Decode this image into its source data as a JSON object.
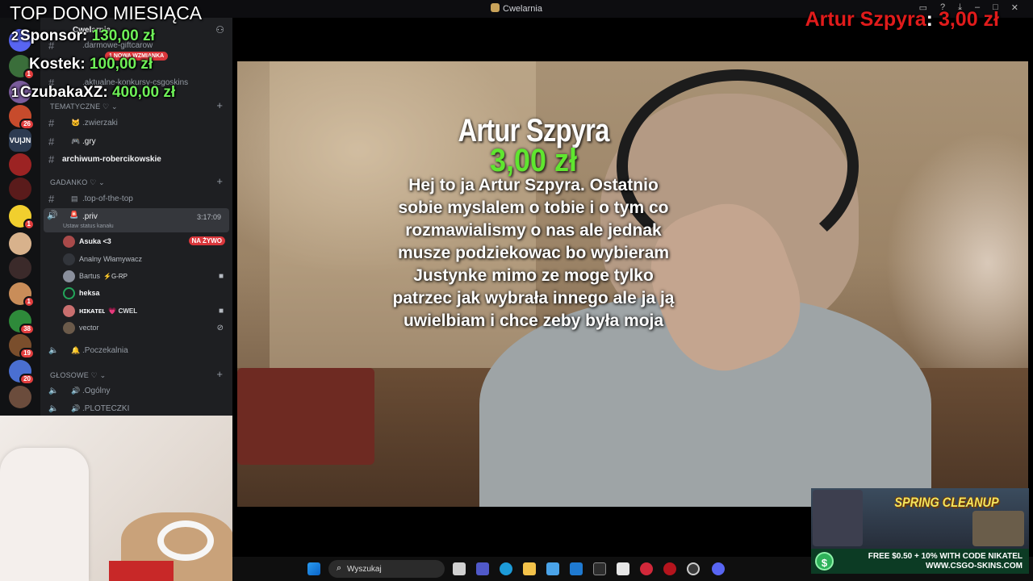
{
  "window": {
    "title": "Cwelarnia"
  },
  "server": {
    "name": "Cwelarnia",
    "mention_badge": "1 NOWA WZMIANKA"
  },
  "channels": {
    "top_items": [
      ".darmowe-giftcarow",
      ".aktualne-konkursy-csgoskins"
    ],
    "tematyczne": {
      "label": "TEMATYCZNE ♡",
      "items": [
        ".zwierzaki",
        ".gry",
        "archiwum-robercikowskie"
      ]
    },
    "gadanko": {
      "label": "GADANKO ♡",
      "items": [
        ".top-of-the-top"
      ]
    },
    "voice_active": {
      "name": ".priv",
      "time": "3:17:09",
      "status": "Ustaw status kanału"
    },
    "members": [
      {
        "name": "Asuka <3",
        "badge": "NA ŻYWO"
      },
      {
        "name": "Analny Włamywacz",
        "tag": ""
      },
      {
        "name": "Bartus",
        "tag": "⚡G-RP"
      },
      {
        "name": "heksa",
        "tag": ""
      },
      {
        "name": "ʜɪᴋᴀᴛᴇʟ",
        "tag": "💗 CWEL"
      },
      {
        "name": "vector",
        "tag": ""
      }
    ],
    "poczekalnia": ".Poczekalnia",
    "glosowe": {
      "label": "GŁOSOWE ♡",
      "items": [
        ".Ogólny",
        ".PLOTECZKI"
      ]
    }
  },
  "server_badges": [
    "1",
    "26",
    "1",
    "1",
    "38",
    "19",
    "20"
  ],
  "server_text_icon": "VU|JN",
  "top_donors": {
    "title": "TOP DONO MIESIĄCA",
    "list": [
      {
        "rank": "2",
        "name": "Sponsor:",
        "amount": "130,00 zł"
      },
      {
        "rank": "",
        "name": "Kostek:",
        "amount": "100,00 zł"
      },
      {
        "rank": "1",
        "name": "CzubakaXZ:",
        "amount": "400,00 zł"
      }
    ]
  },
  "last_donation": {
    "name": "Artur Szpyra",
    "sep": ":",
    "amount": "3,00 zł"
  },
  "alert": {
    "name": "Artur Szpyra",
    "amount": "3,00 zł",
    "message": "Hej to ja Artur Szpyra. Ostatnio sobie myslalem o tobie i o tym co rozmawialismy o nas ale jednak musze podziekowac bo wybieram Justynke mimo ze moge tylko patrzec jak wybrała innego ale ja ją uwielbiam i chce zeby była moja"
  },
  "taskbar": {
    "search_placeholder": "Wyszukaj"
  },
  "ad": {
    "headline": "SPRING CLEANUP",
    "coin": "$",
    "promo_line1": "FREE $0.50 + 10% WITH CODE NIKATEL",
    "promo_line2": "WWW.CSGO-SKINS.COM"
  },
  "colors": {
    "donor_amount": "#6ef058",
    "alert_amount": "#5fe62f",
    "last_donor": "#e01b1b",
    "live_badge": "#da373c"
  }
}
